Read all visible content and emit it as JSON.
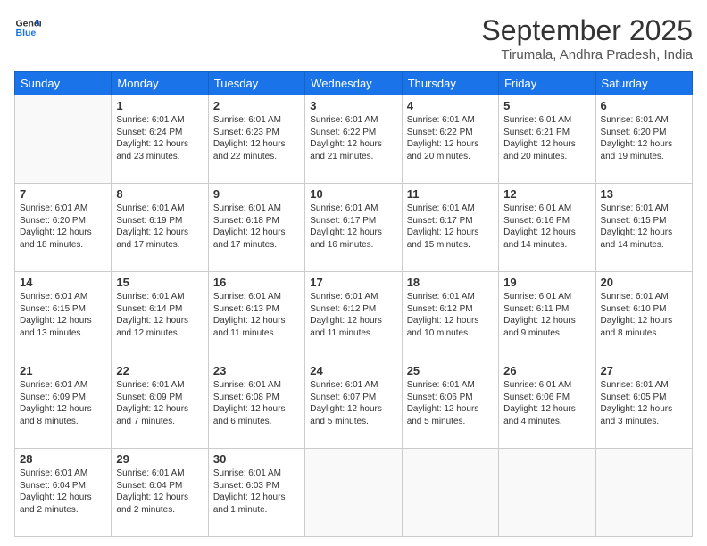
{
  "header": {
    "logo_general": "General",
    "logo_blue": "Blue",
    "title": "September 2025",
    "subtitle": "Tirumala, Andhra Pradesh, India"
  },
  "columns": [
    "Sunday",
    "Monday",
    "Tuesday",
    "Wednesday",
    "Thursday",
    "Friday",
    "Saturday"
  ],
  "weeks": [
    [
      {
        "day": "",
        "info": ""
      },
      {
        "day": "1",
        "info": "Sunrise: 6:01 AM\nSunset: 6:24 PM\nDaylight: 12 hours\nand 23 minutes."
      },
      {
        "day": "2",
        "info": "Sunrise: 6:01 AM\nSunset: 6:23 PM\nDaylight: 12 hours\nand 22 minutes."
      },
      {
        "day": "3",
        "info": "Sunrise: 6:01 AM\nSunset: 6:22 PM\nDaylight: 12 hours\nand 21 minutes."
      },
      {
        "day": "4",
        "info": "Sunrise: 6:01 AM\nSunset: 6:22 PM\nDaylight: 12 hours\nand 20 minutes."
      },
      {
        "day": "5",
        "info": "Sunrise: 6:01 AM\nSunset: 6:21 PM\nDaylight: 12 hours\nand 20 minutes."
      },
      {
        "day": "6",
        "info": "Sunrise: 6:01 AM\nSunset: 6:20 PM\nDaylight: 12 hours\nand 19 minutes."
      }
    ],
    [
      {
        "day": "7",
        "info": "Sunrise: 6:01 AM\nSunset: 6:20 PM\nDaylight: 12 hours\nand 18 minutes."
      },
      {
        "day": "8",
        "info": "Sunrise: 6:01 AM\nSunset: 6:19 PM\nDaylight: 12 hours\nand 17 minutes."
      },
      {
        "day": "9",
        "info": "Sunrise: 6:01 AM\nSunset: 6:18 PM\nDaylight: 12 hours\nand 17 minutes."
      },
      {
        "day": "10",
        "info": "Sunrise: 6:01 AM\nSunset: 6:17 PM\nDaylight: 12 hours\nand 16 minutes."
      },
      {
        "day": "11",
        "info": "Sunrise: 6:01 AM\nSunset: 6:17 PM\nDaylight: 12 hours\nand 15 minutes."
      },
      {
        "day": "12",
        "info": "Sunrise: 6:01 AM\nSunset: 6:16 PM\nDaylight: 12 hours\nand 14 minutes."
      },
      {
        "day": "13",
        "info": "Sunrise: 6:01 AM\nSunset: 6:15 PM\nDaylight: 12 hours\nand 14 minutes."
      }
    ],
    [
      {
        "day": "14",
        "info": "Sunrise: 6:01 AM\nSunset: 6:15 PM\nDaylight: 12 hours\nand 13 minutes."
      },
      {
        "day": "15",
        "info": "Sunrise: 6:01 AM\nSunset: 6:14 PM\nDaylight: 12 hours\nand 12 minutes."
      },
      {
        "day": "16",
        "info": "Sunrise: 6:01 AM\nSunset: 6:13 PM\nDaylight: 12 hours\nand 11 minutes."
      },
      {
        "day": "17",
        "info": "Sunrise: 6:01 AM\nSunset: 6:12 PM\nDaylight: 12 hours\nand 11 minutes."
      },
      {
        "day": "18",
        "info": "Sunrise: 6:01 AM\nSunset: 6:12 PM\nDaylight: 12 hours\nand 10 minutes."
      },
      {
        "day": "19",
        "info": "Sunrise: 6:01 AM\nSunset: 6:11 PM\nDaylight: 12 hours\nand 9 minutes."
      },
      {
        "day": "20",
        "info": "Sunrise: 6:01 AM\nSunset: 6:10 PM\nDaylight: 12 hours\nand 8 minutes."
      }
    ],
    [
      {
        "day": "21",
        "info": "Sunrise: 6:01 AM\nSunset: 6:09 PM\nDaylight: 12 hours\nand 8 minutes."
      },
      {
        "day": "22",
        "info": "Sunrise: 6:01 AM\nSunset: 6:09 PM\nDaylight: 12 hours\nand 7 minutes."
      },
      {
        "day": "23",
        "info": "Sunrise: 6:01 AM\nSunset: 6:08 PM\nDaylight: 12 hours\nand 6 minutes."
      },
      {
        "day": "24",
        "info": "Sunrise: 6:01 AM\nSunset: 6:07 PM\nDaylight: 12 hours\nand 5 minutes."
      },
      {
        "day": "25",
        "info": "Sunrise: 6:01 AM\nSunset: 6:06 PM\nDaylight: 12 hours\nand 5 minutes."
      },
      {
        "day": "26",
        "info": "Sunrise: 6:01 AM\nSunset: 6:06 PM\nDaylight: 12 hours\nand 4 minutes."
      },
      {
        "day": "27",
        "info": "Sunrise: 6:01 AM\nSunset: 6:05 PM\nDaylight: 12 hours\nand 3 minutes."
      }
    ],
    [
      {
        "day": "28",
        "info": "Sunrise: 6:01 AM\nSunset: 6:04 PM\nDaylight: 12 hours\nand 2 minutes."
      },
      {
        "day": "29",
        "info": "Sunrise: 6:01 AM\nSunset: 6:04 PM\nDaylight: 12 hours\nand 2 minutes."
      },
      {
        "day": "30",
        "info": "Sunrise: 6:01 AM\nSunset: 6:03 PM\nDaylight: 12 hours\nand 1 minute."
      },
      {
        "day": "",
        "info": ""
      },
      {
        "day": "",
        "info": ""
      },
      {
        "day": "",
        "info": ""
      },
      {
        "day": "",
        "info": ""
      }
    ]
  ]
}
